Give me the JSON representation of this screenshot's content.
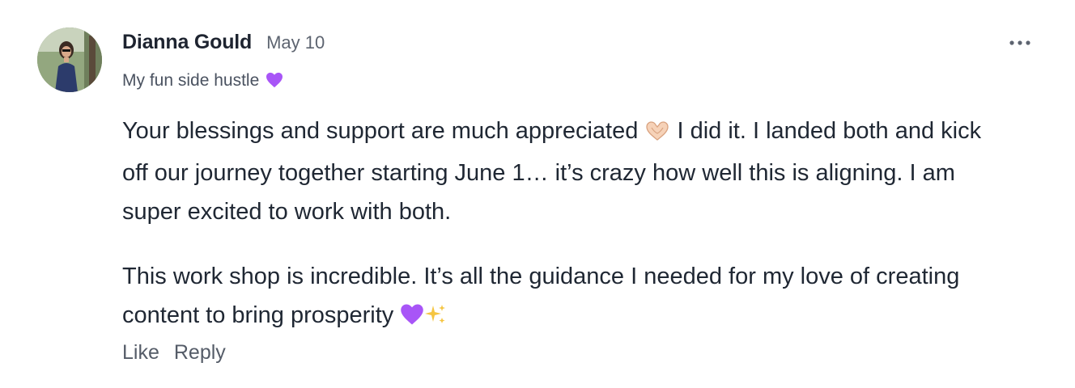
{
  "comment": {
    "author": "Dianna Gould",
    "date": "May 10",
    "subtitle": "My fun side hustle",
    "subtitle_icon": "purple-heart-icon",
    "more_icon": "more-horizontal-icon",
    "paragraph_1_part_1": "Your blessings and support are much appreciated",
    "paragraph_1_icon": "heart-hands-icon",
    "paragraph_1_part_2": "I did it. I landed both and kick off our journey together starting June 1… it’s crazy how well this is aligning. I am super excited to work with both.",
    "paragraph_2": "This work shop is incredible. It’s all the guidance I needed for my love of creating content to bring prosperity",
    "paragraph_2_icons": [
      "purple-heart-icon",
      "sparkles-icon"
    ],
    "like_label": "Like",
    "reply_label": "Reply"
  },
  "colors": {
    "text_primary": "#1f2733",
    "text_secondary": "#5d6470",
    "heart_purple": "#a855f7",
    "sparkle_gold": "#f5c542"
  }
}
